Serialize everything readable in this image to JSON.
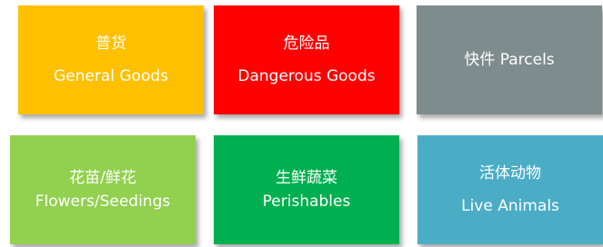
{
  "tiles": [
    {
      "zh": "普货",
      "en": "General Goods",
      "color": "#FFC000"
    },
    {
      "zh": "危险品",
      "en": "Dangerous Goods",
      "color": "#FF0000"
    },
    {
      "label": "快件 Parcels",
      "color": "#7F8C8D"
    },
    {
      "zh": "花苗/鲜花",
      "en": "Flowers/Seedings",
      "color": "#92D050"
    },
    {
      "zh": "生鲜蔬菜",
      "en": "Perishables",
      "color": "#00B050"
    },
    {
      "zh": "活体动物",
      "en": "Live Animals",
      "color": "#4BACC6"
    }
  ]
}
